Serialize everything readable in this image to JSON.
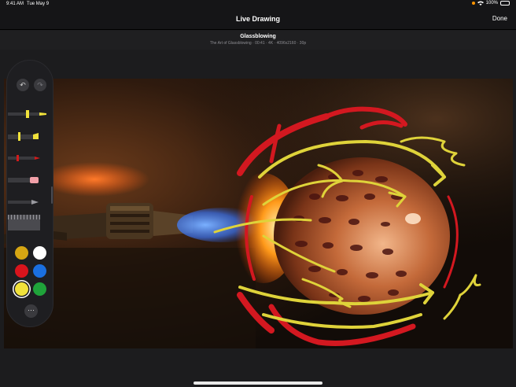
{
  "status_bar": {
    "time": "9:41 AM",
    "date": "Tue May 9",
    "battery": "100%"
  },
  "nav": {
    "title": "Live Drawing",
    "done_label": "Done"
  },
  "video": {
    "title": "Glassblowing",
    "meta": "The Art of Glassblowing · 00:41 · 4K · 4096x2160 · 30p"
  },
  "palette": {
    "tools": [
      {
        "name": "highlighter",
        "tip_color": "#f1e23b"
      },
      {
        "name": "marker",
        "tip_color": "#f1e23b"
      },
      {
        "name": "pen",
        "tip_color": "#d11b1b"
      },
      {
        "name": "eraser",
        "tip_color": "#f1a0a8"
      },
      {
        "name": "pencil",
        "tip_color": "#9a9aa0"
      }
    ],
    "colors": [
      "#d6a613",
      "#ffffff",
      "#d9141c",
      "#1a6fe0",
      "#f1e23b",
      "#1fa33a"
    ],
    "selected_color": "#f1e23b"
  },
  "annotation_colors": {
    "yellow": "#dfd33a",
    "red": "#d31820"
  }
}
